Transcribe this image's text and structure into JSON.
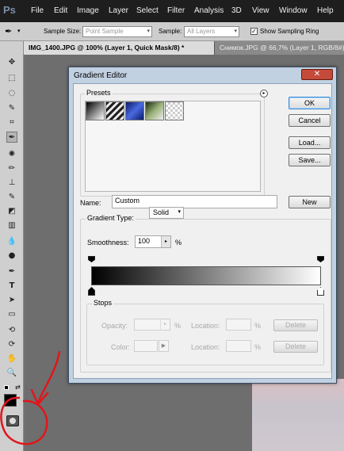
{
  "app": {
    "logo": "Ps"
  },
  "menu": [
    "File",
    "Edit",
    "Image",
    "Layer",
    "Select",
    "Filter",
    "Analysis",
    "3D",
    "View",
    "Window",
    "Help"
  ],
  "options_bar": {
    "sample_size_label": "Sample Size:",
    "sample_size_value": "Point Sample",
    "sample_label": "Sample:",
    "sample_value": "All Layers",
    "show_ring_label": "Show Sampling Ring",
    "show_ring_checked": true
  },
  "tabs": [
    {
      "label": "IMG_1400.JPG @ 100% (Layer 1, Quick Mask/8) *",
      "active": true
    },
    {
      "label": "Снимок.JPG @ 66,7% (Layer 1, RGB/8#)",
      "active": false
    }
  ],
  "dialog": {
    "title": "Gradient Editor",
    "presets_label": "Presets",
    "preset_swatches": [
      "black-white",
      "diagonal-stripes",
      "blue-metal",
      "green-chrome",
      "transparent-checker"
    ],
    "ok": "OK",
    "cancel": "Cancel",
    "load": "Load...",
    "save": "Save...",
    "name_label": "Name:",
    "name_value": "Custom",
    "new": "New",
    "gradient_type_label": "Gradient Type:",
    "gradient_type_value": "Solid",
    "smoothness_label": "Smoothness:",
    "smoothness_value": "100",
    "smoothness_unit": "%",
    "gradient_start_color": "#000000",
    "gradient_end_color": "#ffffff",
    "stops": {
      "legend": "Stops",
      "opacity_label": "Opacity:",
      "opacity_unit": "%",
      "location_label": "Location:",
      "location_unit": "%",
      "delete": "Delete",
      "color_label": "Color:",
      "location2_label": "Location:",
      "location2_unit": "%",
      "delete2": "Delete"
    }
  },
  "annotation_color": "#e0161c"
}
